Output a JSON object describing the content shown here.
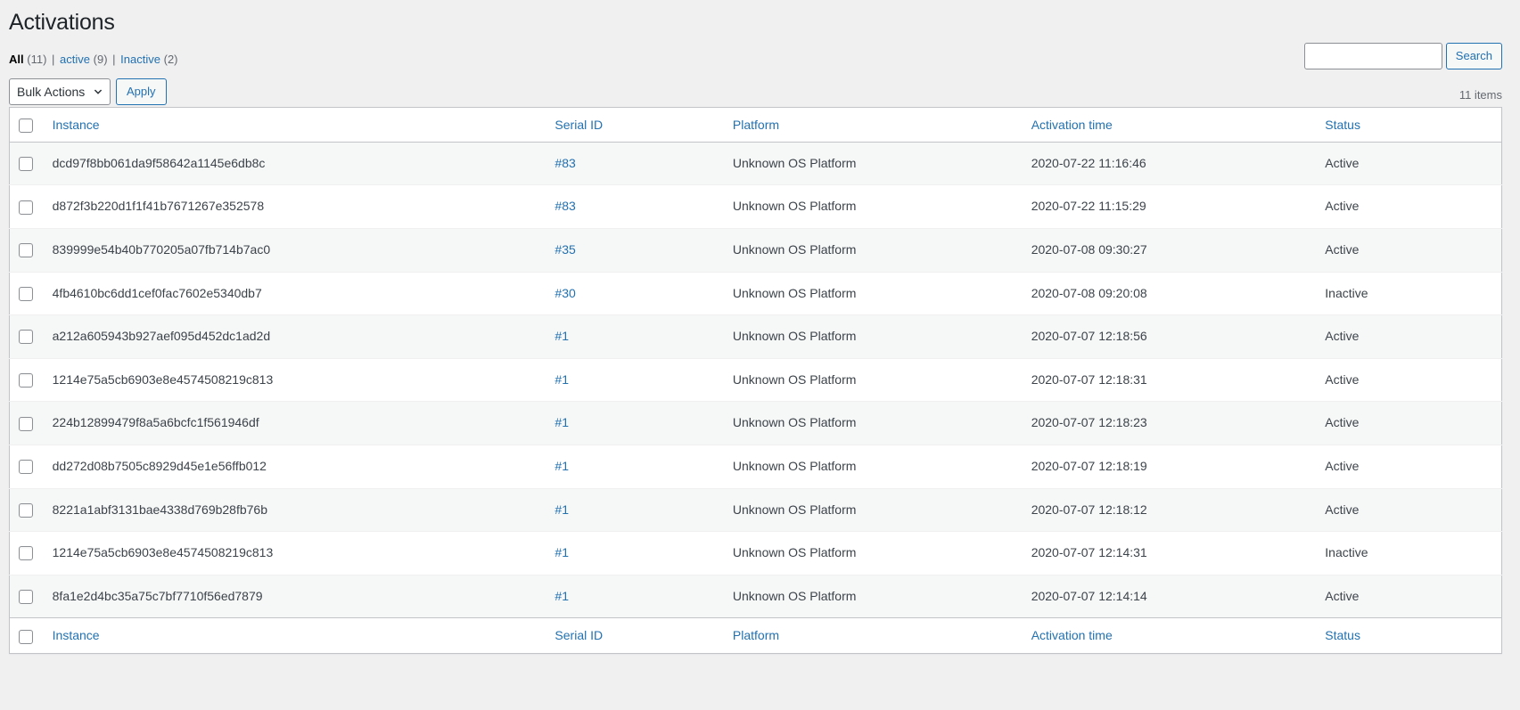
{
  "page": {
    "title": "Activations"
  },
  "filters": {
    "items": [
      {
        "label": "All",
        "count": "(11)",
        "current": true
      },
      {
        "label": "active",
        "count": "(9)",
        "current": false
      },
      {
        "label": "Inactive",
        "count": "(2)",
        "current": false
      }
    ],
    "separator": "|"
  },
  "search": {
    "value": "",
    "placeholder": "",
    "button_label": "Search"
  },
  "toolbar": {
    "bulk_actions_label": "Bulk Actions",
    "bulk_actions_options": [
      "Bulk Actions"
    ],
    "apply_label": "Apply",
    "chevron_icon": "chevron-down-icon"
  },
  "pagination": {
    "displaying_num": "11 items"
  },
  "table": {
    "columns": [
      {
        "key": "instance",
        "label": "Instance"
      },
      {
        "key": "serial",
        "label": "Serial ID"
      },
      {
        "key": "platform",
        "label": "Platform"
      },
      {
        "key": "time",
        "label": "Activation time"
      },
      {
        "key": "status",
        "label": "Status"
      }
    ],
    "rows": [
      {
        "instance": "dcd97f8bb061da9f58642a1145e6db8c",
        "serial": "#83",
        "platform": "Unknown OS Platform",
        "time": "2020-07-22 11:16:46",
        "status": "Active"
      },
      {
        "instance": "d872f3b220d1f1f41b7671267e352578",
        "serial": "#83",
        "platform": "Unknown OS Platform",
        "time": "2020-07-22 11:15:29",
        "status": "Active"
      },
      {
        "instance": "839999e54b40b770205a07fb714b7ac0",
        "serial": "#35",
        "platform": "Unknown OS Platform",
        "time": "2020-07-08 09:30:27",
        "status": "Active"
      },
      {
        "instance": "4fb4610bc6dd1cef0fac7602e5340db7",
        "serial": "#30",
        "platform": "Unknown OS Platform",
        "time": "2020-07-08 09:20:08",
        "status": "Inactive"
      },
      {
        "instance": "a212a605943b927aef095d452dc1ad2d",
        "serial": "#1",
        "platform": "Unknown OS Platform",
        "time": "2020-07-07 12:18:56",
        "status": "Active"
      },
      {
        "instance": "1214e75a5cb6903e8e4574508219c813",
        "serial": "#1",
        "platform": "Unknown OS Platform",
        "time": "2020-07-07 12:18:31",
        "status": "Active"
      },
      {
        "instance": "224b12899479f8a5a6bcfc1f561946df",
        "serial": "#1",
        "platform": "Unknown OS Platform",
        "time": "2020-07-07 12:18:23",
        "status": "Active"
      },
      {
        "instance": "dd272d08b7505c8929d45e1e56ffb012",
        "serial": "#1",
        "platform": "Unknown OS Platform",
        "time": "2020-07-07 12:18:19",
        "status": "Active"
      },
      {
        "instance": "8221a1abf3131bae4338d769b28fb76b",
        "serial": "#1",
        "platform": "Unknown OS Platform",
        "time": "2020-07-07 12:18:12",
        "status": "Active"
      },
      {
        "instance": "1214e75a5cb6903e8e4574508219c813",
        "serial": "#1",
        "platform": "Unknown OS Platform",
        "time": "2020-07-07 12:14:31",
        "status": "Inactive"
      },
      {
        "instance": "8fa1e2d4bc35a75c7bf7710f56ed7879",
        "serial": "#1",
        "platform": "Unknown OS Platform",
        "time": "2020-07-07 12:14:14",
        "status": "Active"
      }
    ]
  },
  "colors": {
    "link": "#2271b1",
    "text": "#3c434a",
    "page_bg": "#f0f0f1",
    "row_alt_bg": "#f6f7f7",
    "border": "#c3c4c7"
  }
}
